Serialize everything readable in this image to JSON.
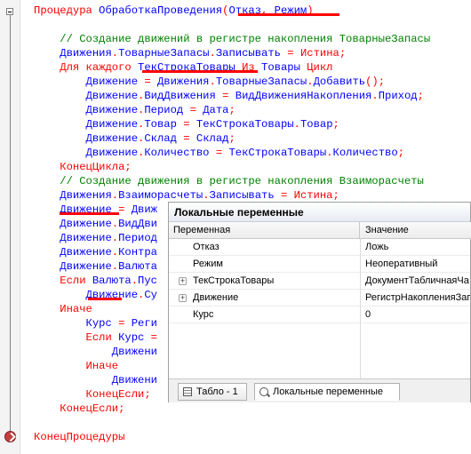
{
  "code": {
    "lines": [
      {
        "tokens": [
          {
            "t": "Процедура ",
            "c": "kw"
          },
          {
            "t": "ОбработкаПроведения",
            "c": "id"
          },
          {
            "t": "(",
            "c": "kw"
          },
          {
            "t": "Отказ",
            "c": "id"
          },
          {
            "t": ", ",
            "c": "kw"
          },
          {
            "t": "Режим",
            "c": "id"
          },
          {
            "t": ")",
            "c": "kw"
          }
        ]
      },
      {
        "tokens": []
      },
      {
        "tokens": [
          {
            "t": "    // Создание движений в регистре накопления ТоварныеЗапасы",
            "c": "cm"
          }
        ]
      },
      {
        "tokens": [
          {
            "t": "    ",
            "c": "id"
          },
          {
            "t": "Движения",
            "c": "id"
          },
          {
            "t": ".",
            "c": "kw"
          },
          {
            "t": "ТоварныеЗапасы",
            "c": "id"
          },
          {
            "t": ".",
            "c": "kw"
          },
          {
            "t": "Записывать",
            "c": "id"
          },
          {
            "t": " = ",
            "c": "kw"
          },
          {
            "t": "Истина",
            "c": "kw"
          },
          {
            "t": ";",
            "c": "kw"
          }
        ]
      },
      {
        "tokens": [
          {
            "t": "    Для каждого ",
            "c": "kw"
          },
          {
            "t": "ТекСтрокаТовары",
            "c": "id"
          },
          {
            "t": " Из ",
            "c": "kw"
          },
          {
            "t": "Товары",
            "c": "id"
          },
          {
            "t": " Цикл",
            "c": "kw"
          }
        ]
      },
      {
        "tokens": [
          {
            "t": "        ",
            "c": "id"
          },
          {
            "t": "Движение",
            "c": "id"
          },
          {
            "t": " = ",
            "c": "kw"
          },
          {
            "t": "Движения",
            "c": "id"
          },
          {
            "t": ".",
            "c": "kw"
          },
          {
            "t": "ТоварныеЗапасы",
            "c": "id"
          },
          {
            "t": ".",
            "c": "kw"
          },
          {
            "t": "Добавить",
            "c": "id"
          },
          {
            "t": "();",
            "c": "kw"
          }
        ]
      },
      {
        "tokens": [
          {
            "t": "        ",
            "c": "id"
          },
          {
            "t": "Движение",
            "c": "id"
          },
          {
            "t": ".",
            "c": "kw"
          },
          {
            "t": "ВидДвижения",
            "c": "id"
          },
          {
            "t": " = ",
            "c": "kw"
          },
          {
            "t": "ВидДвиженияНакопления",
            "c": "id"
          },
          {
            "t": ".",
            "c": "kw"
          },
          {
            "t": "Приход",
            "c": "id"
          },
          {
            "t": ";",
            "c": "kw"
          }
        ]
      },
      {
        "tokens": [
          {
            "t": "        ",
            "c": "id"
          },
          {
            "t": "Движение",
            "c": "id"
          },
          {
            "t": ".",
            "c": "kw"
          },
          {
            "t": "Период",
            "c": "id"
          },
          {
            "t": " = ",
            "c": "kw"
          },
          {
            "t": "Дата",
            "c": "id"
          },
          {
            "t": ";",
            "c": "kw"
          }
        ]
      },
      {
        "tokens": [
          {
            "t": "        ",
            "c": "id"
          },
          {
            "t": "Движение",
            "c": "id"
          },
          {
            "t": ".",
            "c": "kw"
          },
          {
            "t": "Товар",
            "c": "id"
          },
          {
            "t": " = ",
            "c": "kw"
          },
          {
            "t": "ТекСтрокаТовары",
            "c": "id"
          },
          {
            "t": ".",
            "c": "kw"
          },
          {
            "t": "Товар",
            "c": "id"
          },
          {
            "t": ";",
            "c": "kw"
          }
        ]
      },
      {
        "tokens": [
          {
            "t": "        ",
            "c": "id"
          },
          {
            "t": "Движение",
            "c": "id"
          },
          {
            "t": ".",
            "c": "kw"
          },
          {
            "t": "Склад",
            "c": "id"
          },
          {
            "t": " = ",
            "c": "kw"
          },
          {
            "t": "Склад",
            "c": "id"
          },
          {
            "t": ";",
            "c": "kw"
          }
        ]
      },
      {
        "tokens": [
          {
            "t": "        ",
            "c": "id"
          },
          {
            "t": "Движение",
            "c": "id"
          },
          {
            "t": ".",
            "c": "kw"
          },
          {
            "t": "Количество",
            "c": "id"
          },
          {
            "t": " = ",
            "c": "kw"
          },
          {
            "t": "ТекСтрокаТовары",
            "c": "id"
          },
          {
            "t": ".",
            "c": "kw"
          },
          {
            "t": "Количество",
            "c": "id"
          },
          {
            "t": ";",
            "c": "kw"
          }
        ]
      },
      {
        "tokens": [
          {
            "t": "    КонецЦикла;",
            "c": "kw"
          }
        ]
      },
      {
        "tokens": [
          {
            "t": "    // Создание движения в регистре накопления Взаиморасчеты",
            "c": "cm"
          }
        ]
      },
      {
        "tokens": [
          {
            "t": "    ",
            "c": "id"
          },
          {
            "t": "Движения",
            "c": "id"
          },
          {
            "t": ".",
            "c": "kw"
          },
          {
            "t": "Взаиморасчеты",
            "c": "id"
          },
          {
            "t": ".",
            "c": "kw"
          },
          {
            "t": "Записывать",
            "c": "id"
          },
          {
            "t": " = ",
            "c": "kw"
          },
          {
            "t": "Истина",
            "c": "kw"
          },
          {
            "t": ";",
            "c": "kw"
          }
        ]
      },
      {
        "tokens": [
          {
            "t": "    ",
            "c": "id"
          },
          {
            "t": "Движение",
            "c": "id"
          },
          {
            "t": " = ",
            "c": "kw"
          },
          {
            "t": "Движ",
            "c": "id"
          }
        ]
      },
      {
        "tokens": [
          {
            "t": "    ",
            "c": "id"
          },
          {
            "t": "Движение",
            "c": "id"
          },
          {
            "t": ".",
            "c": "kw"
          },
          {
            "t": "ВидДви",
            "c": "id"
          }
        ]
      },
      {
        "tokens": [
          {
            "t": "    ",
            "c": "id"
          },
          {
            "t": "Движение",
            "c": "id"
          },
          {
            "t": ".",
            "c": "kw"
          },
          {
            "t": "Период",
            "c": "id"
          }
        ]
      },
      {
        "tokens": [
          {
            "t": "    ",
            "c": "id"
          },
          {
            "t": "Движение",
            "c": "id"
          },
          {
            "t": ".",
            "c": "kw"
          },
          {
            "t": "Контра",
            "c": "id"
          }
        ]
      },
      {
        "tokens": [
          {
            "t": "    ",
            "c": "id"
          },
          {
            "t": "Движение",
            "c": "id"
          },
          {
            "t": ".",
            "c": "kw"
          },
          {
            "t": "Валюта",
            "c": "id"
          }
        ]
      },
      {
        "tokens": [
          {
            "t": "    Если ",
            "c": "kw"
          },
          {
            "t": "Валюта",
            "c": "id"
          },
          {
            "t": ".",
            "c": "kw"
          },
          {
            "t": "Пус",
            "c": "id"
          }
        ]
      },
      {
        "tokens": [
          {
            "t": "        ",
            "c": "id"
          },
          {
            "t": "Движение",
            "c": "id"
          },
          {
            "t": ".",
            "c": "kw"
          },
          {
            "t": "Су",
            "c": "id"
          }
        ]
      },
      {
        "tokens": [
          {
            "t": "    Иначе",
            "c": "kw"
          }
        ]
      },
      {
        "tokens": [
          {
            "t": "        ",
            "c": "id"
          },
          {
            "t": "Курс",
            "c": "id"
          },
          {
            "t": " = ",
            "c": "kw"
          },
          {
            "t": "Реги",
            "c": "id"
          }
        ]
      },
      {
        "tokens": [
          {
            "t": "        Если ",
            "c": "kw"
          },
          {
            "t": "Курс",
            "c": "id"
          },
          {
            "t": " =",
            "c": "kw"
          }
        ]
      },
      {
        "tokens": [
          {
            "t": "            ",
            "c": "id"
          },
          {
            "t": "Движени",
            "c": "id"
          }
        ]
      },
      {
        "tokens": [
          {
            "t": "        Иначе",
            "c": "kw"
          }
        ]
      },
      {
        "tokens": [
          {
            "t": "            ",
            "c": "id"
          },
          {
            "t": "Движени",
            "c": "id"
          }
        ]
      },
      {
        "tokens": [
          {
            "t": "        КонецЕсли;",
            "c": "kw"
          }
        ]
      },
      {
        "tokens": [
          {
            "t": "    КонецЕсли;",
            "c": "kw"
          }
        ]
      },
      {
        "tokens": []
      },
      {
        "tokens": [
          {
            "t": "КонецПроцедуры",
            "c": "kw"
          }
        ]
      }
    ]
  },
  "colors": {
    "keyword": "#ff0000",
    "identifier": "#0000ff",
    "comment": "#008000",
    "underline": "#ff0000"
  },
  "locals_panel": {
    "title": "Локальные переменные",
    "columns": {
      "name": "Переменная",
      "value": "Значение"
    },
    "rows": [
      {
        "name": "Отказ",
        "value": "Ложь",
        "expandable": false
      },
      {
        "name": "Режим",
        "value": "Неоперативный",
        "expandable": false
      },
      {
        "name": "ТекСтрокаТовары",
        "value": "ДокументТабличнаяЧа",
        "expandable": true
      },
      {
        "name": "Движение",
        "value": "РегистрНакопленияЗап",
        "expandable": true
      },
      {
        "name": "Курс",
        "value": "0",
        "expandable": false
      }
    ],
    "expander_glyph": "+",
    "tabs": [
      {
        "label": "Табло - 1",
        "icon": "table-icon"
      },
      {
        "label": "Локальные переменные",
        "icon": "watch-icon"
      }
    ]
  }
}
